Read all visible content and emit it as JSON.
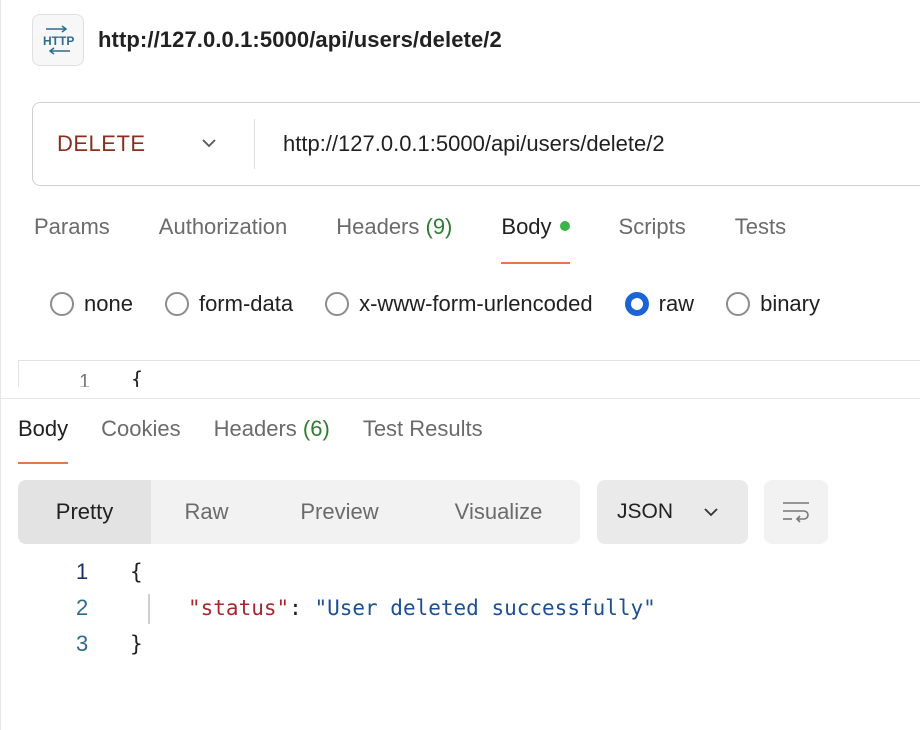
{
  "header": {
    "icon": "http-icon",
    "title": "http://127.0.0.1:5000/api/users/delete/2"
  },
  "request": {
    "method": "DELETE",
    "url": "http://127.0.0.1:5000/api/users/delete/2",
    "tabs": [
      {
        "label": "Params"
      },
      {
        "label": "Authorization"
      },
      {
        "label": "Headers",
        "count": "(9)"
      },
      {
        "label": "Body",
        "active": true
      },
      {
        "label": "Scripts"
      },
      {
        "label": "Tests"
      }
    ],
    "body_types": [
      {
        "label": "none",
        "checked": false
      },
      {
        "label": "form-data",
        "checked": false
      },
      {
        "label": "x-www-form-urlencoded",
        "checked": false
      },
      {
        "label": "raw",
        "checked": true
      },
      {
        "label": "binary",
        "checked": false
      }
    ],
    "editor": {
      "line": "1",
      "text": "{"
    }
  },
  "response": {
    "tabs": [
      {
        "label": "Body",
        "active": true
      },
      {
        "label": "Cookies"
      },
      {
        "label": "Headers",
        "count": "(6)"
      },
      {
        "label": "Test Results"
      }
    ],
    "view_modes": [
      "Pretty",
      "Raw",
      "Preview",
      "Visualize"
    ],
    "active_view": "Pretty",
    "format": "JSON",
    "lines": [
      {
        "num": "1",
        "open": "{"
      },
      {
        "num": "2",
        "key": "\"status\"",
        "sep": ": ",
        "value": "\"User deleted successfully\""
      },
      {
        "num": "3",
        "close": "}"
      }
    ]
  },
  "colors": {
    "method": "#8a2f1f",
    "accent": "#e8764a",
    "count": "#2f7d32",
    "radio_checked": "#1a64d6",
    "json_key": "#a3292f",
    "json_string": "#1d4f91"
  }
}
